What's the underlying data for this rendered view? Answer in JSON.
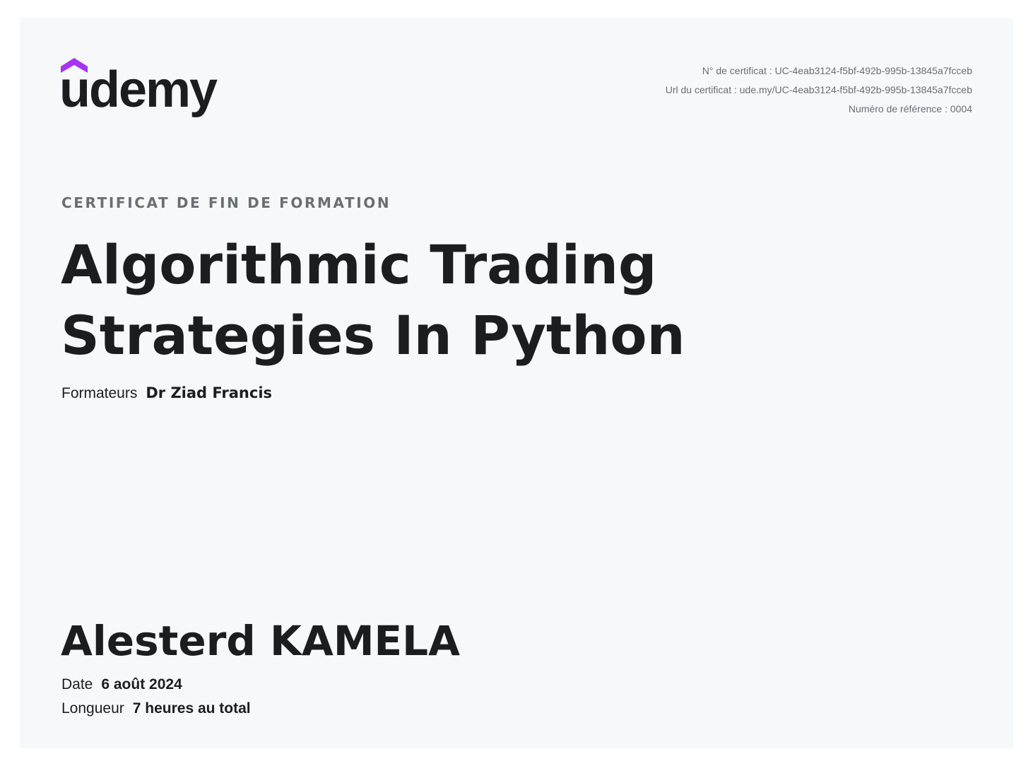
{
  "brand": {
    "logo_text": "udemy",
    "accent_color": "#a435f0",
    "text_color": "#1c1d1f"
  },
  "certificate": {
    "number": "N° de certificat : UC-4eab3124-f5bf-492b-995b-13845a7fcceb",
    "url": "Url du certificat : ude.my/UC-4eab3124-f5bf-492b-995b-13845a7fcceb",
    "reference": "Numéro de référence : 0004"
  },
  "heading": "CERTIFICAT DE FIN DE FORMATION",
  "course": {
    "title_line1": "Algorithmic Trading",
    "title_line2": "Strategies In Python"
  },
  "instructors": {
    "label": "Formateurs",
    "name": "Dr Ziad Francis"
  },
  "student": {
    "name": "Alesterd KAMELA"
  },
  "details": {
    "date_label": "Date",
    "date_value": "6 août 2024",
    "length_label": "Longueur",
    "length_value": "7 heures au total"
  }
}
